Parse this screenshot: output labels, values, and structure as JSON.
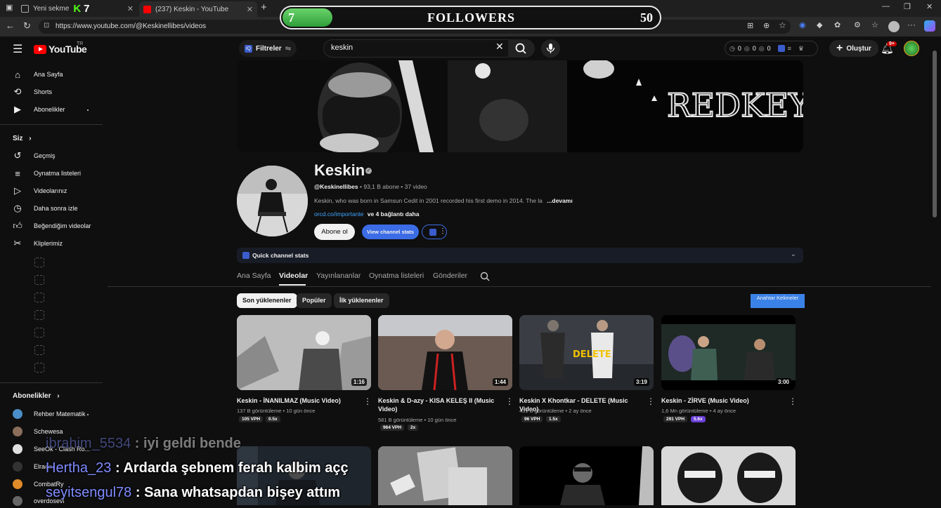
{
  "browser": {
    "tabs": [
      {
        "label": "Yeni sekme"
      },
      {
        "label": "(237) Keskin - YouTube"
      }
    ],
    "url": "https://www.youtube.com/@Keskinellibes/videos",
    "kick_badge": "7"
  },
  "overlay": {
    "followers_current": "7",
    "followers_label": "FOLLOWERS",
    "followers_goal": "50",
    "progress_fraction": 0.14
  },
  "header": {
    "logo": "YouTube",
    "country": "TR",
    "filters_label": "Filtreler",
    "search_value": "keskin",
    "stats": [
      "0",
      "0",
      "0"
    ],
    "create_label": "Oluştur",
    "notif_count": "9+"
  },
  "sidebar": {
    "main": [
      {
        "label": "Ana Sayfa",
        "icon": "home-icon"
      },
      {
        "label": "Shorts",
        "icon": "shorts-icon"
      },
      {
        "label": "Abonelikler",
        "icon": "subscriptions-icon"
      }
    ],
    "you_heading": "Siz",
    "you": [
      {
        "label": "Geçmiş",
        "icon": "history-icon"
      },
      {
        "label": "Oynatma listeleri",
        "icon": "playlist-icon"
      },
      {
        "label": "Videolarınız",
        "icon": "your-videos-icon"
      },
      {
        "label": "Daha sonra izle",
        "icon": "watch-later-icon"
      },
      {
        "label": "Beğendiğim videolar",
        "icon": "liked-icon"
      },
      {
        "label": "Kliplerimiz",
        "icon": "clips-icon"
      }
    ],
    "subs_heading": "Abonelikler",
    "subs": [
      {
        "label": "Rehber Matematik",
        "color": "#4a8fc9"
      },
      {
        "label": "Schewesa",
        "color": "#8a6d5a"
      },
      {
        "label": "SeeOk - Clash Ro...",
        "color": "#e0e0e0"
      },
      {
        "label": "Elraen",
        "color": "#333333"
      },
      {
        "label": "CombatRy",
        "color": "#e08a2a"
      },
      {
        "label": "overdosevl",
        "color": "#666666"
      }
    ]
  },
  "channel": {
    "name": "Keskin",
    "handle": "@Keskinellibes",
    "subscribers": "93,1 B abone",
    "video_count": "37 video",
    "description": "Keskin, who was born in Samsun Cedit in 2001 recorded his first demo in 2014.  The la",
    "more": "...devamı",
    "link": "orcd.co/importante",
    "link_more": "ve 4 bağlantı daha",
    "subscribe_label": "Abone ol",
    "stats_label": "View channel stats",
    "quick_stats_label": "Quick channel stats",
    "banner_text": "REDKEYS"
  },
  "tabs": [
    "Ana Sayfa",
    "Videolar",
    "Yayınlananlar",
    "Oynatma listeleri",
    "Gönderiler"
  ],
  "chips": [
    "Son yüklenenler",
    "Popüler",
    "İlk yüklenenler"
  ],
  "keywords_label": "Anahtar Kelimeler",
  "videos": [
    {
      "title": "Keskin - İNANILMAZ (Music Video)",
      "views": "137 B görüntüleme",
      "age": "10 gün önce",
      "duration": "1:16",
      "vph": "105 VPH",
      "mult": "0.5x",
      "mult_color": "#272727"
    },
    {
      "title": "Keskin & D-azy - KISA KELEŞ II (Music Video)",
      "views": "581 B görüntüleme",
      "age": "10 gün önce",
      "duration": "1:44",
      "vph": "964 VPH",
      "mult": "2x",
      "mult_color": "#272727"
    },
    {
      "title": "Keskin X Khontkar - DELETE (Music Video)",
      "views": "431 B görüntüleme",
      "age": "2 ay önce",
      "duration": "3:19",
      "vph": "96 VPH",
      "mult": "1.5x",
      "mult_color": "#272727"
    },
    {
      "title": "Keskin - ZİRVE (Music Video)",
      "views": "1,6 Mn görüntüleme",
      "age": "4 ay önce",
      "duration": "3:00",
      "vph": "291 VPH",
      "mult": "5.6x",
      "mult_color": "#6a3fd6"
    }
  ],
  "chat": [
    {
      "user": "ibrahim_5534",
      "msg": " : iyi geldi bende"
    },
    {
      "user": "Hertha_23",
      "msg": " : Ardarda şebnem ferah kalbim açç"
    },
    {
      "user": "seyitsengul78",
      "msg": " : Sana whatsapdan bişey attım"
    }
  ]
}
